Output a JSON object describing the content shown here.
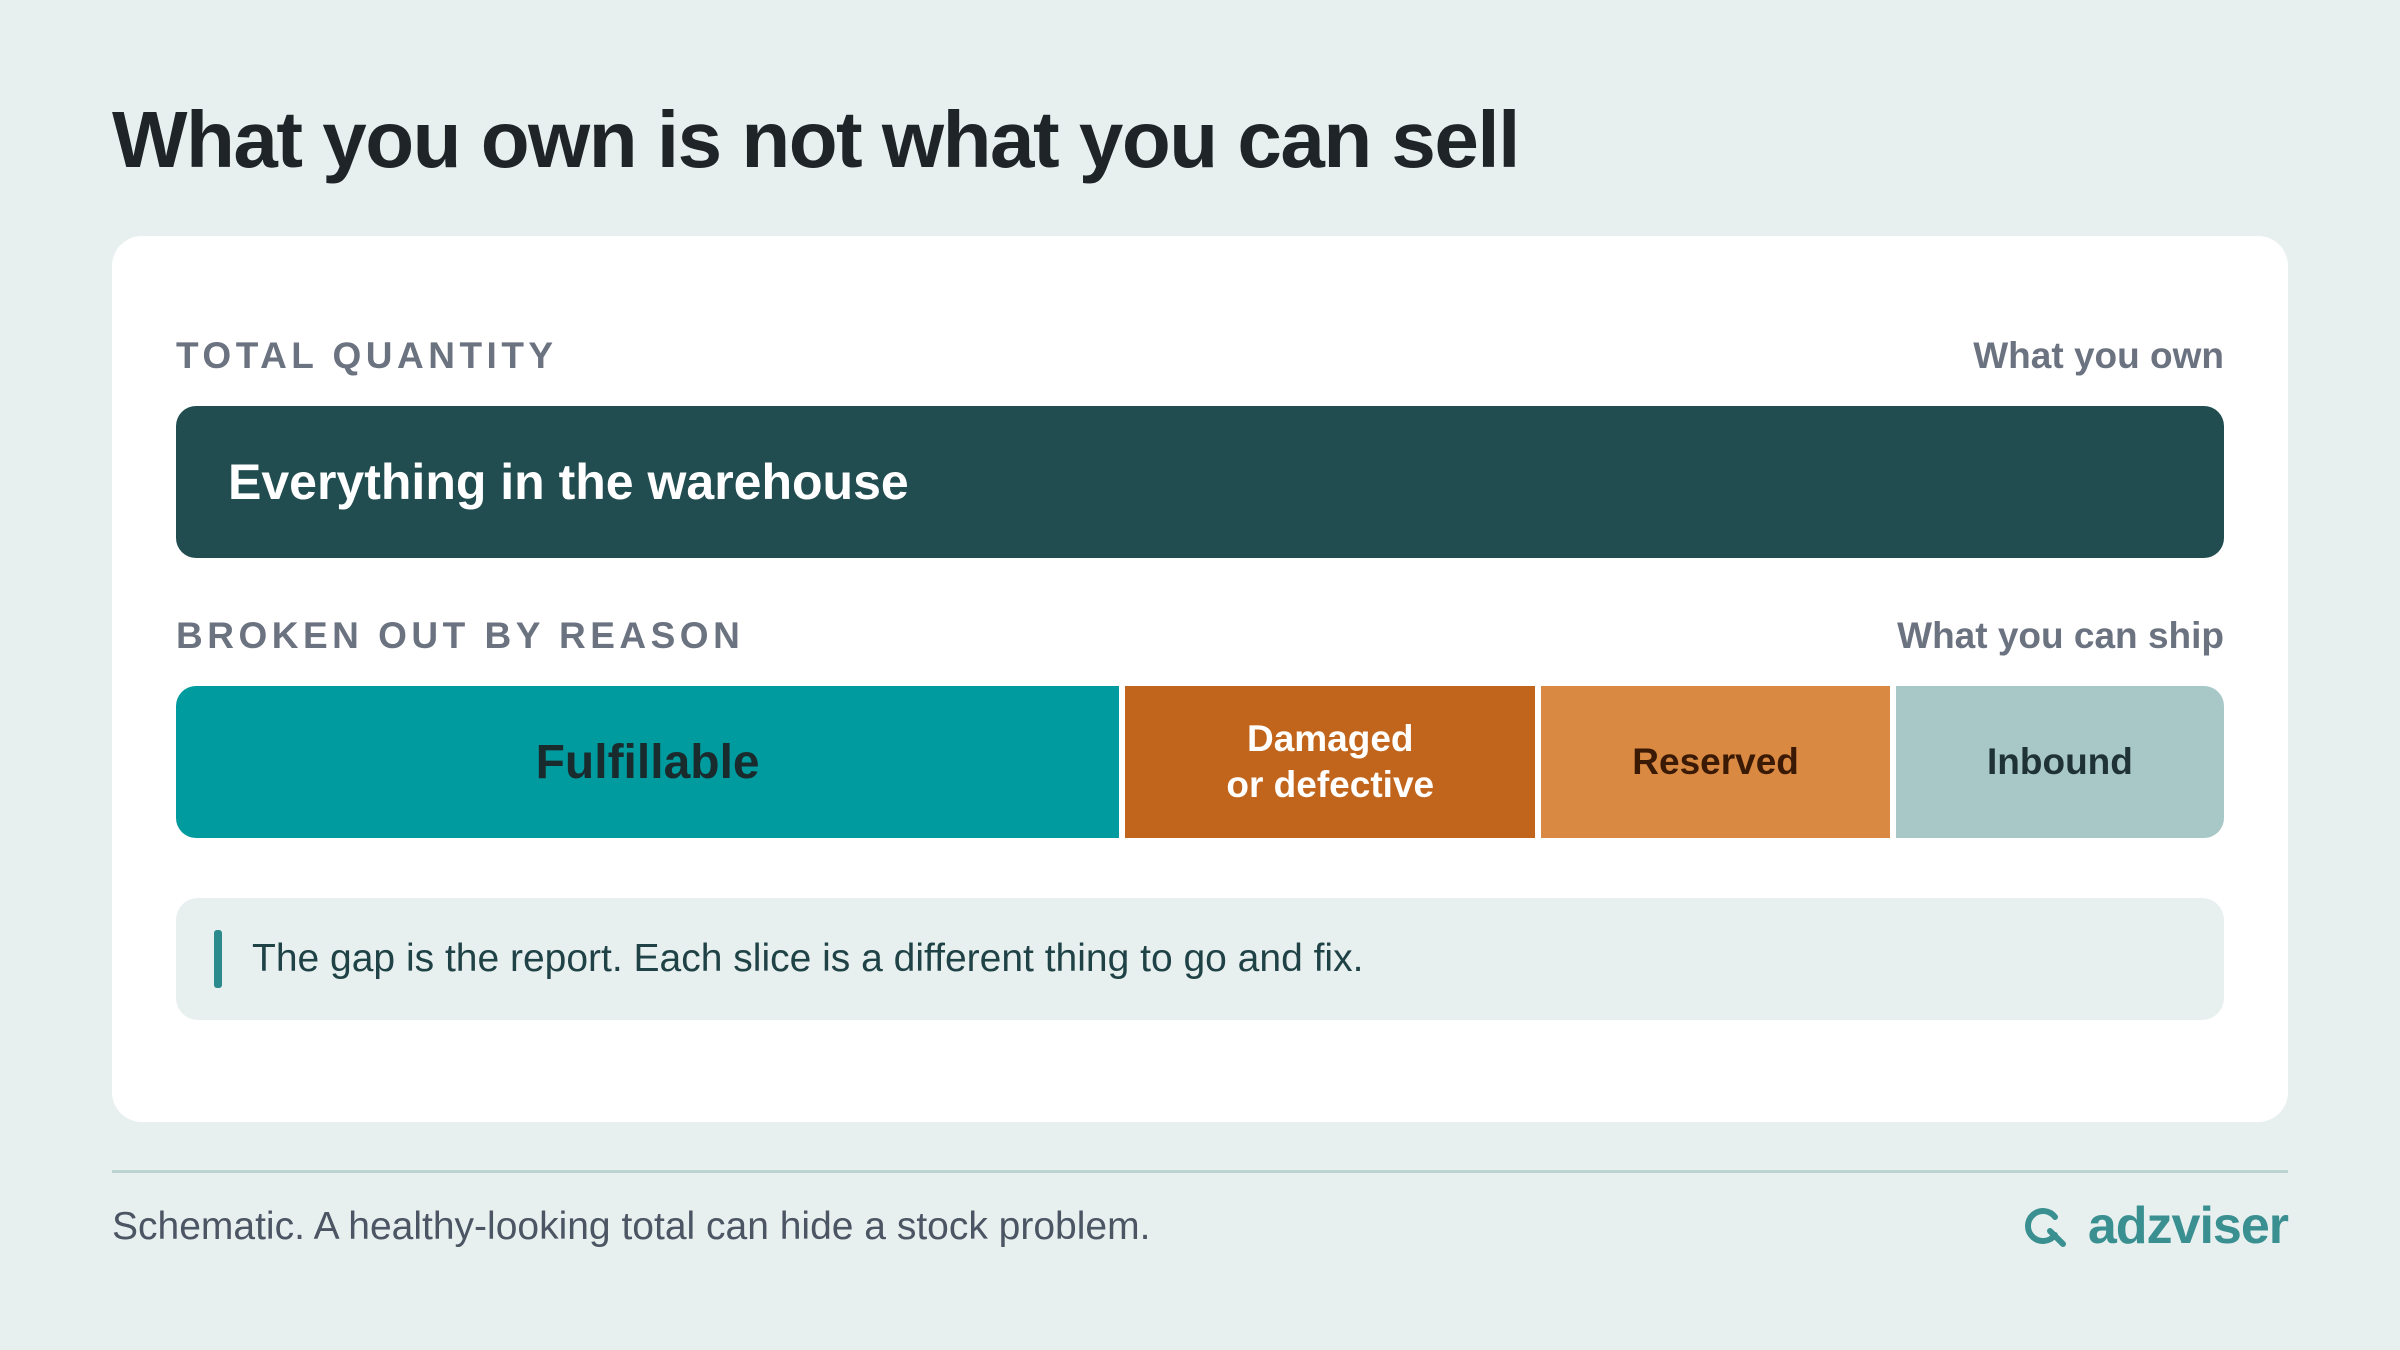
{
  "title": "What you own is not what you can sell",
  "total": {
    "label": "TOTAL QUANTITY",
    "note": "What you own",
    "bar_label": "Everything in the warehouse",
    "bar_color": "#214c50"
  },
  "breakdown": {
    "label": "BROKEN OUT BY REASON",
    "note": "What you can ship",
    "segments": [
      {
        "label": "Fulfillable",
        "share": 0.46,
        "color": "#009b9e",
        "text_color": "#1a2b2e"
      },
      {
        "label": "Damaged\nor defective",
        "share": 0.2,
        "color": "#c2651c",
        "text_color": "#ffffff"
      },
      {
        "label": "Reserved",
        "share": 0.17,
        "color": "#d98941",
        "text_color": "#3a1a05"
      },
      {
        "label": "Inbound",
        "share": 0.16,
        "color": "#a8c7c7",
        "text_color": "#1f3336"
      }
    ]
  },
  "callout": {
    "text": "The gap is the report. Each slice is a different thing to go and fix.",
    "accent_color": "#2a8a8c"
  },
  "footer": {
    "note": "Schematic. A healthy-looking total can hide a stock problem."
  },
  "brand": {
    "name": "adzviser",
    "icon": "magnifier-logo-icon",
    "color": "#3a8f91"
  }
}
